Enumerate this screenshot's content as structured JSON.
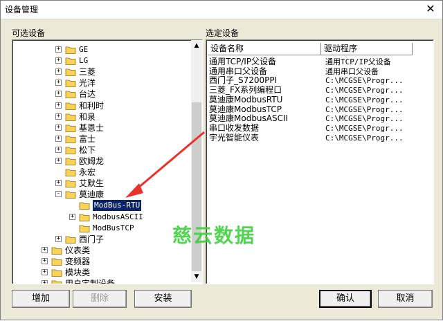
{
  "window": {
    "title": "设备管理",
    "close_glyph": "✕"
  },
  "left_panel": {
    "label": "可选设备",
    "tree": [
      {
        "label": "GE",
        "level": 1,
        "expander": "+"
      },
      {
        "label": "LG",
        "level": 1,
        "expander": "+"
      },
      {
        "label": "三菱",
        "level": 1,
        "expander": "+"
      },
      {
        "label": "光洋",
        "level": 1,
        "expander": "+"
      },
      {
        "label": "台达",
        "level": 1,
        "expander": "+"
      },
      {
        "label": "和利时",
        "level": 1,
        "expander": "+"
      },
      {
        "label": "和泉",
        "level": 1,
        "expander": "+"
      },
      {
        "label": "基恩士",
        "level": 1,
        "expander": "+"
      },
      {
        "label": "富士",
        "level": 1,
        "expander": "+"
      },
      {
        "label": "松下",
        "level": 1,
        "expander": "+"
      },
      {
        "label": "欧姆龙",
        "level": 1,
        "expander": "+"
      },
      {
        "label": "永宏",
        "level": 1,
        "expander": ""
      },
      {
        "label": "艾默生",
        "level": 1,
        "expander": "+"
      },
      {
        "label": "莫迪康",
        "level": 1,
        "expander": "-"
      },
      {
        "label": "ModBus-RTU",
        "level": 2,
        "expander": "",
        "selected": true
      },
      {
        "label": "ModbusASCII",
        "level": 2,
        "expander": "+"
      },
      {
        "label": "ModBusTCP",
        "level": 2,
        "expander": ""
      },
      {
        "label": "西门子",
        "level": 1,
        "expander": "+"
      },
      {
        "label": "仪表类",
        "level": 0,
        "expander": "+"
      },
      {
        "label": "变频器",
        "level": 0,
        "expander": "+"
      },
      {
        "label": "模块类",
        "level": 0,
        "expander": "+"
      },
      {
        "label": "用户定制设备",
        "level": 0,
        "expander": "+"
      }
    ]
  },
  "right_panel": {
    "label": "选定设备",
    "columns": [
      "设备名称",
      "驱动程序"
    ],
    "rows": [
      {
        "name": "通用TCP/IP父设备",
        "driver": "通用TCP/IP父设备"
      },
      {
        "name": "通用串口父设备",
        "driver": "通用串口父设备"
      },
      {
        "name": "西门子_S7200PPI",
        "driver": "C:\\MCGSE\\Progr..."
      },
      {
        "name": "三菱_FX系列编程口",
        "driver": "C:\\MCGSE\\Progr..."
      },
      {
        "name": "莫迪康ModbusRTU",
        "driver": "C:\\MCGSE\\Progr..."
      },
      {
        "name": "莫迪康ModbusTCP",
        "driver": "C:\\MCGSE\\Progr..."
      },
      {
        "name": "莫迪康ModbusASCII",
        "driver": "C:\\MCGSE\\Progr..."
      },
      {
        "name": "串口收发数据",
        "driver": "C:\\MCGSE\\Progr..."
      },
      {
        "name": "宇光智能仪表",
        "driver": "C:\\MCGSE\\Progr..."
      }
    ]
  },
  "buttons": {
    "add": "增加",
    "delete": "删除",
    "install": "安装",
    "ok": "确认",
    "cancel": "取消"
  },
  "watermark": "慈云数据",
  "colors": {
    "selection": "#0a246a",
    "annotation_arrow": "#e8322a",
    "watermark": "#3fd13f"
  },
  "icons": {
    "folder": "folder-icon",
    "close": "close-icon",
    "scroll_up": "scroll-up-icon",
    "scroll_down": "scroll-down-icon"
  }
}
